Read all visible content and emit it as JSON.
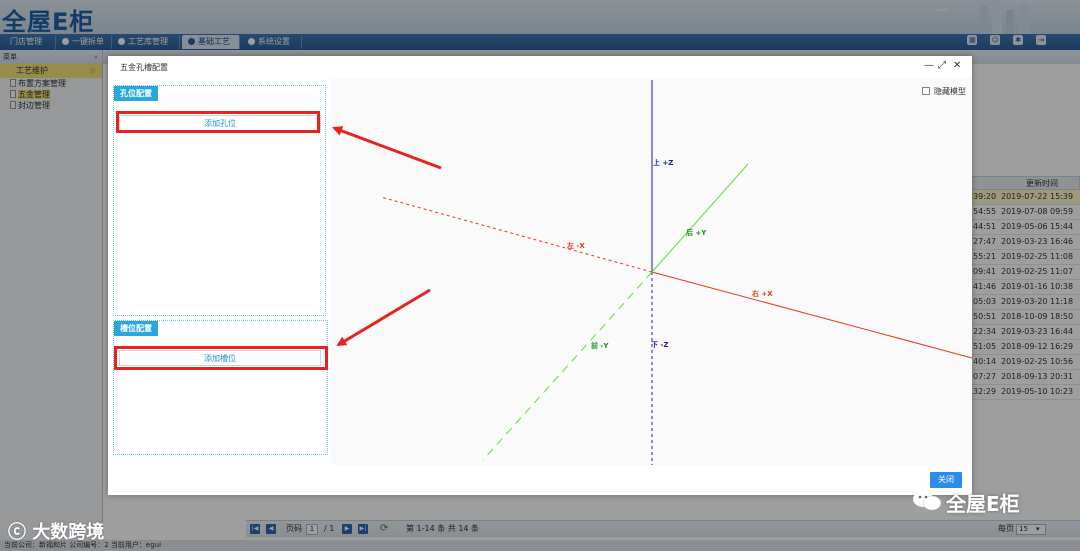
{
  "app": {
    "logo": "全屋E柜",
    "nav": [
      {
        "label": "门店管理",
        "active": false
      },
      {
        "label": "一键拆单",
        "active": false
      },
      {
        "label": "工艺库管理",
        "active": false
      },
      {
        "label": "基础工艺",
        "active": true
      },
      {
        "label": "系统设置",
        "active": false
      }
    ]
  },
  "sidebar": {
    "header": "菜单",
    "collapse": "«",
    "group": "工艺维护",
    "group_icon": "☆",
    "items": [
      {
        "label": "布置方案管理",
        "selected": false
      },
      {
        "label": "五金管理",
        "selected": true
      },
      {
        "label": "封边管理",
        "selected": false
      }
    ]
  },
  "grid": {
    "header": "更新时间",
    "rows": [
      [
        "39:20",
        "2019-07-22 15:39"
      ],
      [
        "54:55",
        "2019-07-08 09:59"
      ],
      [
        "44:51",
        "2019-05-06 15:44"
      ],
      [
        "27:47",
        "2019-03-23 16:46"
      ],
      [
        "55:21",
        "2019-02-25 11:08"
      ],
      [
        "09:41",
        "2019-02-25 11:07"
      ],
      [
        "41:46",
        "2019-01-16 10:38"
      ],
      [
        "05:03",
        "2019-03-20 11:18"
      ],
      [
        "50:51",
        "2018-10-09 18:50"
      ],
      [
        "22:34",
        "2019-03-23 16:44"
      ],
      [
        "51:05",
        "2018-09-12 16:29"
      ],
      [
        "40:14",
        "2019-02-25 10:56"
      ],
      [
        "07:27",
        "2018-09-13 20:31"
      ],
      [
        "32:29",
        "2019-05-10 10:23"
      ]
    ]
  },
  "pager": {
    "page_label": "页码",
    "page": "1",
    "of": "/ 1",
    "summary": "第 1-14 条  共 14 条",
    "per_page_label": "每页",
    "per_page": "15"
  },
  "status": {
    "text": "当前公司：新福和片   公司编号：2    当前用户：egui"
  },
  "modal": {
    "title": "五金孔槽配置",
    "minimize": "—",
    "maximize": "⤢",
    "close": "✕",
    "hole_panel": {
      "tag": "孔位配置",
      "button": "添加孔位"
    },
    "slot_panel": {
      "tag": "槽位配置",
      "button": "添加槽位"
    },
    "hide_model": "隐藏模型",
    "close_button": "关闭",
    "axes": {
      "up": "上 +Z",
      "down": "下 -Z",
      "left": "左 -X",
      "right": "右 +X",
      "back": "后 +Y",
      "front": "前 -Y"
    },
    "colors": {
      "z": "#1a1aa8",
      "x": "#e53a1e",
      "y": "#5ee03a"
    }
  },
  "watermarks": {
    "left": "大数跨境",
    "right": "全屋E柜"
  }
}
